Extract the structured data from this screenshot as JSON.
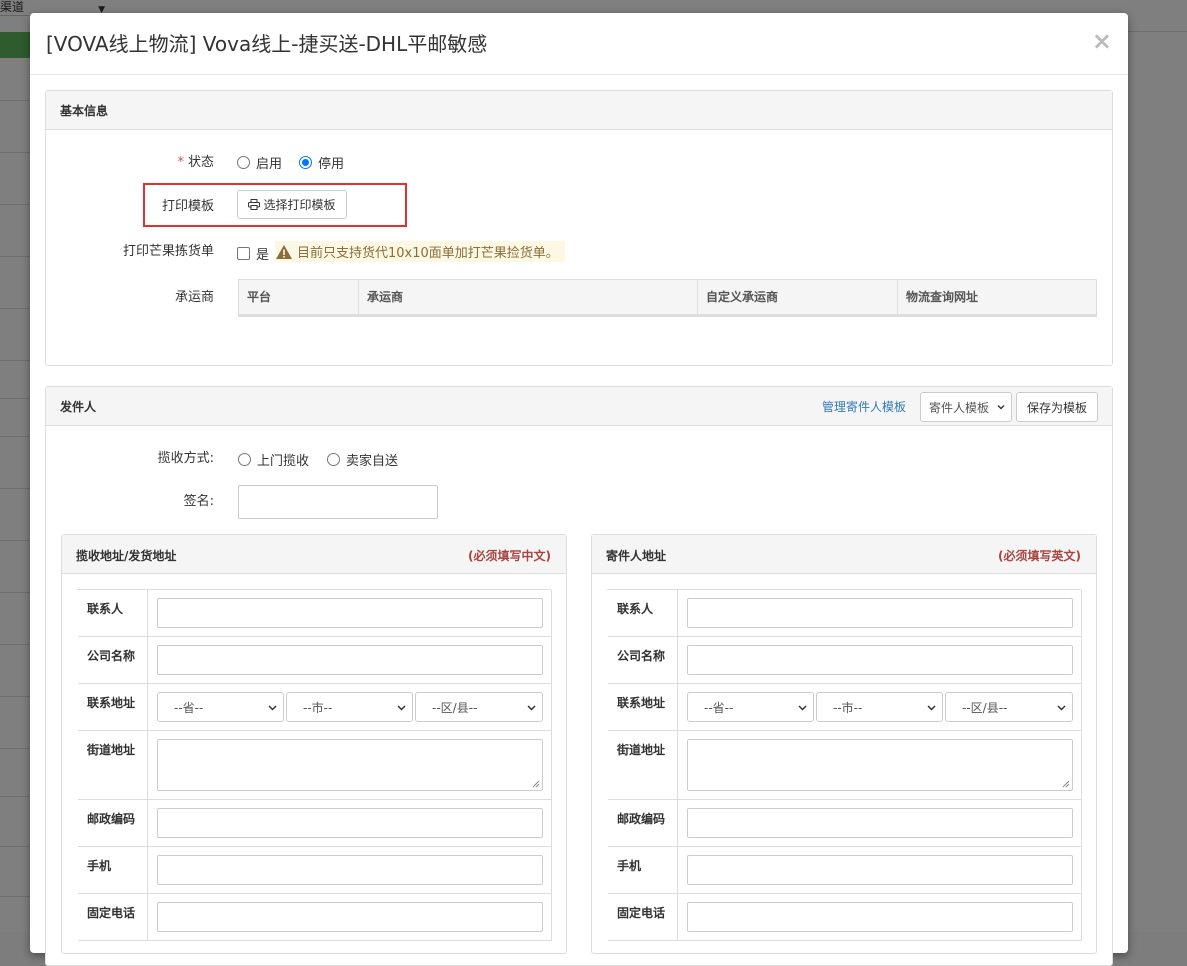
{
  "background": {
    "topbar_label": "渠道"
  },
  "modal": {
    "title": "[VOVA线上物流] Vova线上-捷买送-DHL平邮敏感",
    "close_label": "×"
  },
  "basic_info": {
    "heading": "基本信息",
    "status": {
      "required_mark": "*",
      "label": "状态",
      "options": [
        {
          "label": "启用",
          "checked": false
        },
        {
          "label": "停用",
          "checked": true
        }
      ]
    },
    "print_template": {
      "label": "打印模板",
      "button_label": "选择打印模板",
      "icon": "print-icon"
    },
    "mango_pick": {
      "label": "打印芒果拣货单",
      "checkbox_label": "是",
      "warning": "目前只支持货代10x10面单加打芒果捡货单。",
      "warning_icon": "warning-icon"
    },
    "carrier": {
      "label": "承运商",
      "columns": [
        "平台",
        "承运商",
        "自定义承运商",
        "物流查询网址"
      ]
    }
  },
  "sender": {
    "heading": "发件人",
    "manage_link": "管理寄件人模板",
    "template_select": "寄件人模板",
    "save_button": "保存为模板",
    "pickup": {
      "label": "揽收方式:",
      "options": [
        {
          "label": "上门揽收",
          "checked": false
        },
        {
          "label": "卖家自送",
          "checked": false
        }
      ]
    },
    "signature": {
      "label": "签名:",
      "value": ""
    }
  },
  "address_panels": [
    {
      "title": "揽收地址/发货地址",
      "note": "(必须填写中文)",
      "rows": [
        "联系人",
        "公司名称",
        "联系地址",
        "街道地址",
        "邮政编码",
        "手机",
        "固定电话"
      ],
      "province": "--省--",
      "city": "--市--",
      "district": "--区/县--"
    },
    {
      "title": "寄件人地址",
      "note": "(必须填写英文)",
      "rows": [
        "联系人",
        "公司名称",
        "联系地址",
        "街道地址",
        "邮政编码",
        "手机",
        "固定电话"
      ],
      "province": "--省--",
      "city": "--市--",
      "district": "--区/县--"
    }
  ],
  "colors": {
    "accent": "#337ab7",
    "highlight_box": "#e03030",
    "note_red": "#a94442",
    "warning_bg": "#fcf8e3",
    "warning_text": "#8a6d3b",
    "radio_checked": "#0075ff"
  }
}
